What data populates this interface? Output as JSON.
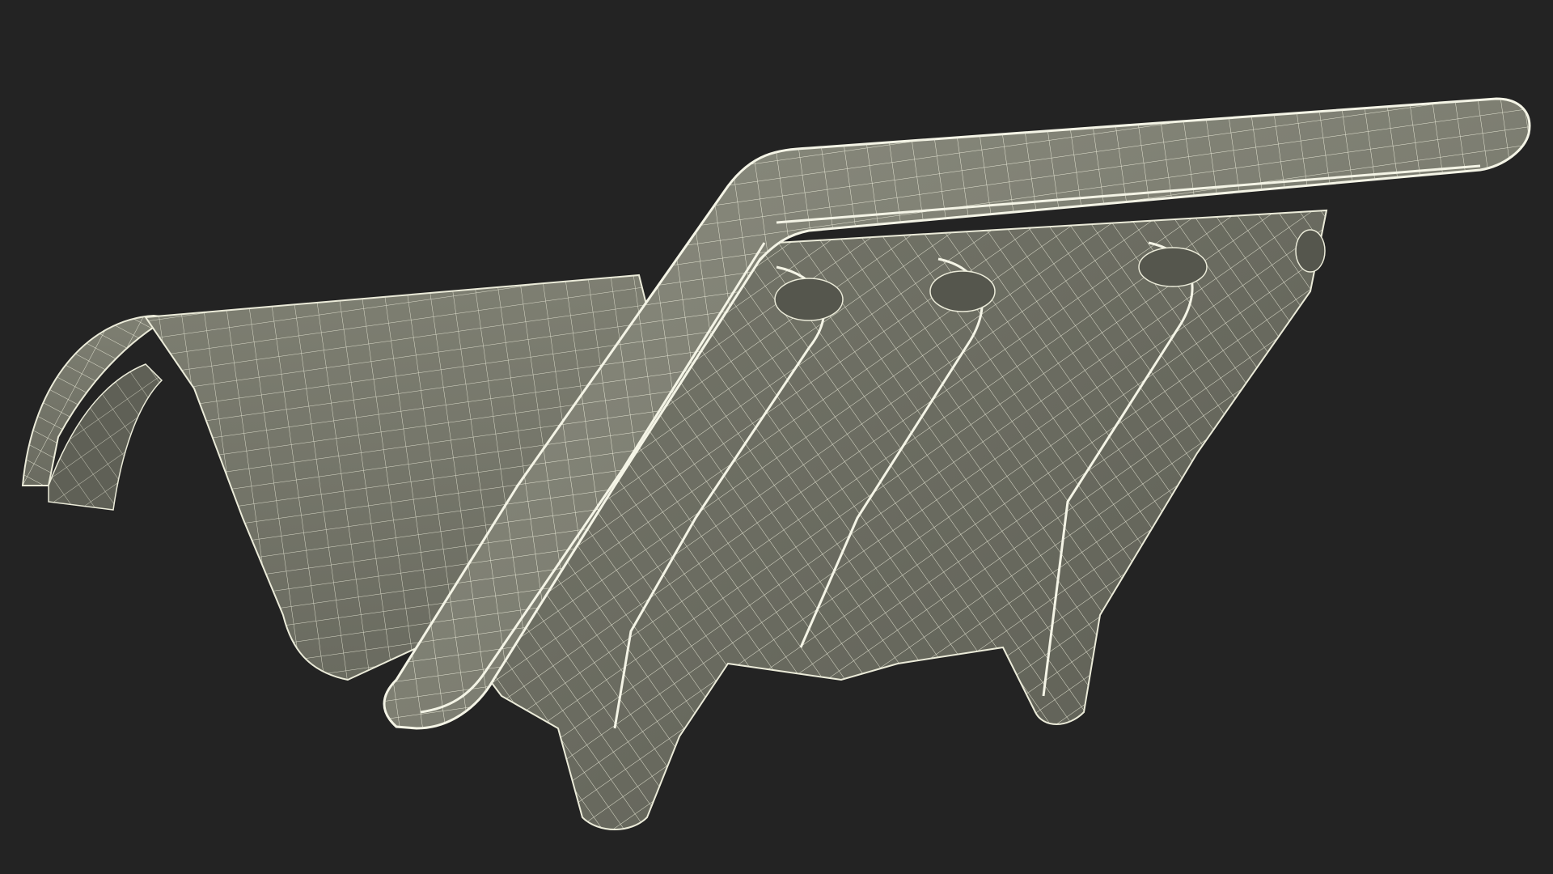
{
  "scene": {
    "background_color": "#232323",
    "object": {
      "kind": "3d-wireframe-mesh",
      "shape": "curved bracket part with ribbed underside",
      "surface_color": "#7b7c6f",
      "surface_shadow_color": "#5f6056",
      "wire_color": "#ebebd9",
      "edge_highlight_color": "#f4f4e6"
    }
  }
}
